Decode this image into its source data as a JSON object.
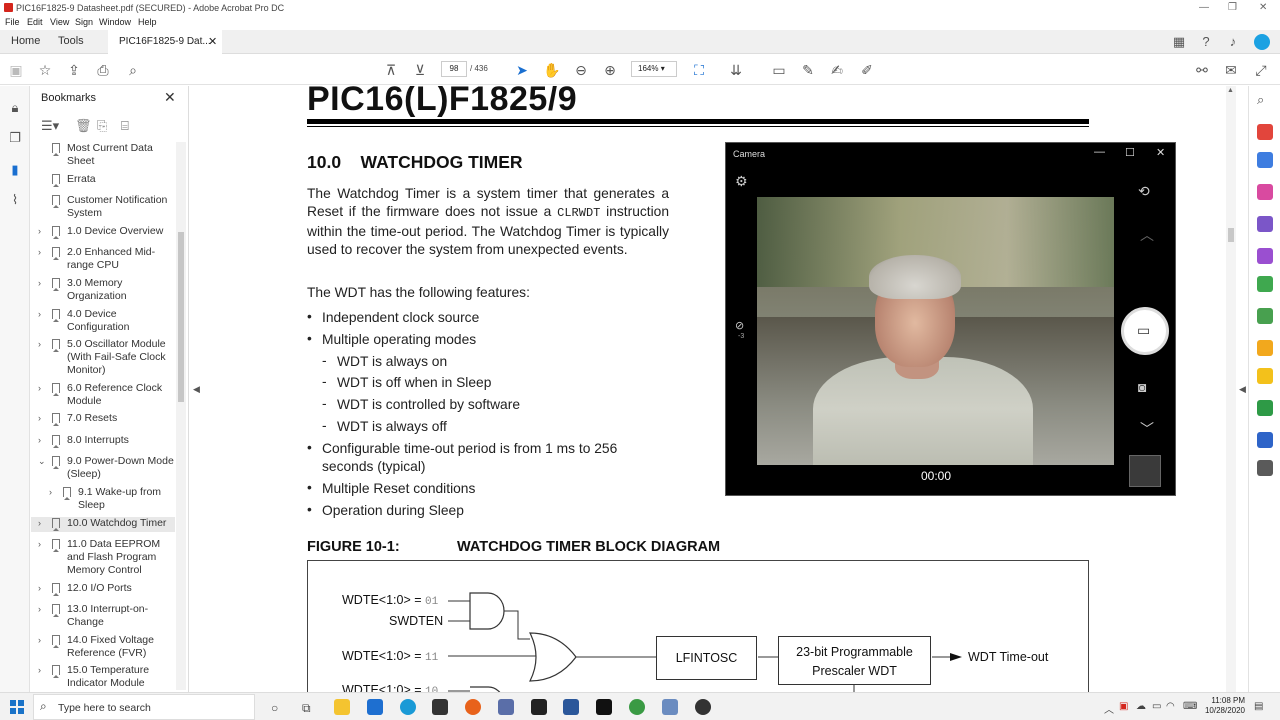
{
  "window": {
    "title": "PIC16F1825-9 Datasheet.pdf (SECURED) - Adobe Acrobat Pro DC",
    "minimize": "—",
    "maximize": "❐",
    "close": "✕"
  },
  "menu": [
    "File",
    "Edit",
    "View",
    "Sign",
    "Window",
    "Help"
  ],
  "tabs": {
    "home": "Home",
    "tools": "Tools",
    "document": "PIC16F1825-9 Dat...",
    "close": "✕"
  },
  "toolbar": {
    "page_current": "98",
    "page_total": "/ 436",
    "zoom": "164%"
  },
  "bookmarks": {
    "title": "Bookmarks",
    "close": "✕",
    "items": [
      {
        "label": "Most Current Data Sheet",
        "expandable": false
      },
      {
        "label": "Errata",
        "expandable": false
      },
      {
        "label": "Customer Notification System",
        "expandable": false
      },
      {
        "label": "1.0 Device Overview",
        "expandable": true
      },
      {
        "label": "2.0 Enhanced Mid-range CPU",
        "expandable": true
      },
      {
        "label": "3.0 Memory Organization",
        "expandable": true
      },
      {
        "label": "4.0 Device Configuration",
        "expandable": true
      },
      {
        "label": "5.0 Oscillator Module (With Fail-Safe Clock Monitor)",
        "expandable": true
      },
      {
        "label": "6.0 Reference Clock Module",
        "expandable": true
      },
      {
        "label": "7.0 Resets",
        "expandable": true
      },
      {
        "label": "8.0 Interrupts",
        "expandable": true
      },
      {
        "label": "9.0 Power-Down Mode (Sleep)",
        "expandable": true,
        "expanded": true
      },
      {
        "label": "9.1 Wake-up from Sleep",
        "expandable": true,
        "child": true
      },
      {
        "label": "10.0 Watchdog Timer",
        "expandable": true,
        "selected": true
      },
      {
        "label": "11.0 Data EEPROM and Flash Program Memory Control",
        "expandable": true
      },
      {
        "label": "12.0 I/O Ports",
        "expandable": true
      },
      {
        "label": "13.0 Interrupt-on-Change",
        "expandable": true
      },
      {
        "label": "14.0 Fixed Voltage Reference (FVR)",
        "expandable": true
      },
      {
        "label": "15.0 Temperature Indicator Module",
        "expandable": true
      }
    ]
  },
  "document": {
    "title": "PIC16(L)F1825/9",
    "section_number": "10.0",
    "section_title": "WATCHDOG TIMER",
    "intro_before": "The Watchdog Timer is a system timer that generates a Reset if the firmware does not issue a ",
    "intro_code": "CLRWDT",
    "intro_after": " instruction within the time-out period. The Watchdog Timer is typically used to recover the system from unexpected events.",
    "features_intro": "The WDT has the following features:",
    "features": {
      "f1": "Independent clock source",
      "f2": "Multiple operating modes",
      "s1": "WDT is always on",
      "s2": "WDT is off when in Sleep",
      "s3": "WDT is controlled by software",
      "s4": "WDT is always off",
      "f3a": "Configurable time-out period is from 1 ms to 256",
      "f3b": "seconds (typical)",
      "f4": "Multiple Reset conditions",
      "f5": "Operation during Sleep"
    },
    "figure_label": "FIGURE 10-1:",
    "figure_title": "WATCHDOG TIMER BLOCK DIAGRAM",
    "diagram": {
      "wdte1": "WDTE<1:0> = ",
      "wdte1_val": "01",
      "swdten": "SWDTEN",
      "wdte2": "WDTE<1:0> = ",
      "wdte2_val": "11",
      "wdte3": "WDTE<1:0> = ",
      "wdte3_val": "10",
      "lfintosc": "LFINTOSC",
      "prescaler_1": "23-bit Programmable",
      "prescaler_2": "Prescaler WDT",
      "timeout": "WDT Time-out"
    }
  },
  "camera": {
    "title": "Camera",
    "timer": "00:00",
    "exposure": "-3"
  },
  "taskbar": {
    "search_placeholder": "Type here to search",
    "time": "11:08 PM",
    "date": "10/28/2020"
  },
  "colors": {
    "acrobat_red": "#d4251c",
    "selection": "#e8e8e8",
    "taskbar": "#f2f2f2"
  }
}
